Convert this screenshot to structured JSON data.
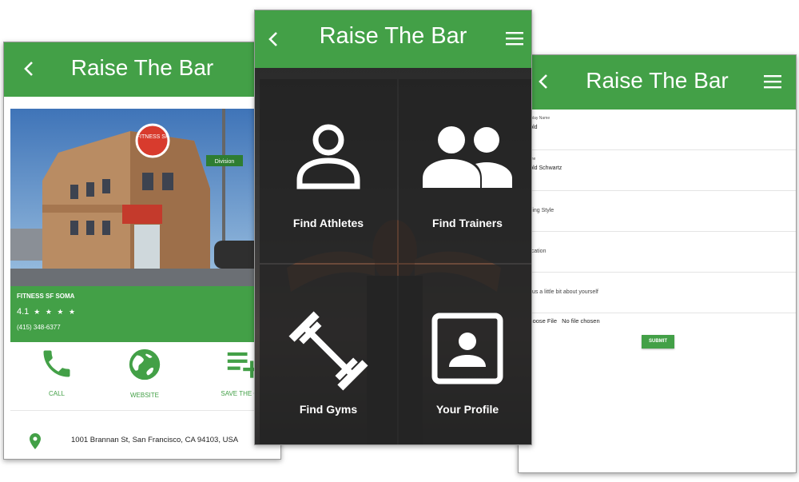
{
  "brand": {
    "green": "#43a047",
    "dark_tile": "#222222"
  },
  "gym_screen": {
    "title": "Raise The Bar",
    "gym_name": "FITNESS SF SOMA",
    "rating": "4.1",
    "stars": "★ ★ ★ ★",
    "phone": "(415) 348-6377",
    "actions": [
      {
        "label": "CALL",
        "icon": "phone-icon"
      },
      {
        "label": "WEBSITE",
        "icon": "globe-icon"
      },
      {
        "label": "SAVE THE GYM",
        "icon": "playlist-add-icon"
      }
    ],
    "address": "1001 Brannan St, San Francisco, CA 94103, USA",
    "photo_sign": "FITNESS SF",
    "street_sign": "Division"
  },
  "dashboard_screen": {
    "title": "Raise The Bar",
    "tiles": [
      {
        "label": "Find Athletes",
        "icon": "person-icon"
      },
      {
        "label": "Find Trainers",
        "icon": "people-icon"
      },
      {
        "label": "Find Gyms",
        "icon": "dumbbell-icon"
      },
      {
        "label": "Your Profile",
        "icon": "profile-card-icon"
      }
    ]
  },
  "profile_screen": {
    "title": "Raise The Bar",
    "fields": [
      {
        "label": "Display Name",
        "value": "rnold"
      },
      {
        "label": "Name",
        "value": "rnold Schwartz"
      },
      {
        "placeholder": "aining Style"
      },
      {
        "placeholder": "Location"
      },
      {
        "placeholder": "ell us a little bit about yourself"
      }
    ],
    "file_button": "Choose File",
    "file_status": "No file chosen",
    "submit": "SUBMIT"
  }
}
